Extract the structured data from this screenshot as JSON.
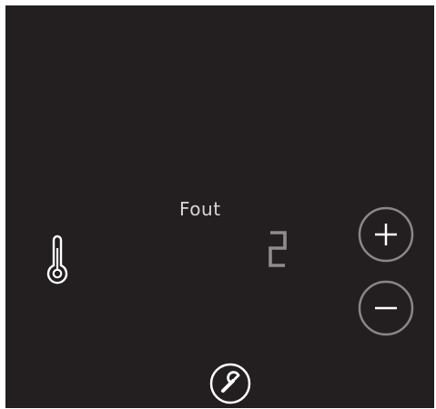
{
  "panel": {
    "error_label": "Fout",
    "display_value": "2"
  },
  "icons": {
    "thermometer": "thermometer-icon",
    "plus": "plus-icon",
    "minus": "minus-icon",
    "wrench": "wrench-icon"
  },
  "colors": {
    "background": "#231f20",
    "text": "#d8d6d6",
    "digit": "#8f8c8c",
    "button_ring": "#8a8787",
    "icon": "#ffffff"
  }
}
